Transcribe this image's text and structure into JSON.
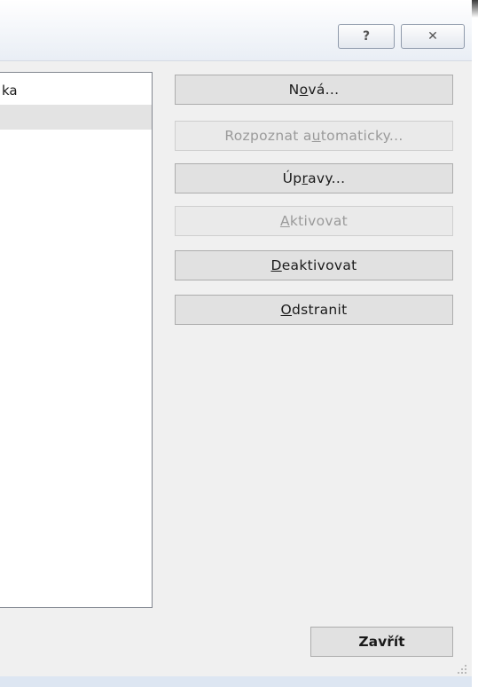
{
  "titlebar": {
    "help_glyph": "?",
    "close_glyph": "✕"
  },
  "list": {
    "items": [
      "ka",
      ""
    ]
  },
  "buttons": {
    "new": {
      "pre": "N",
      "u": "o",
      "post": "vá..."
    },
    "auto": {
      "pre": "Rozpoznat a",
      "u": "u",
      "post": "tomaticky..."
    },
    "edit": {
      "pre": "Úp",
      "u": "r",
      "post": "avy..."
    },
    "activate": {
      "pre": "",
      "u": "A",
      "post": "ktivovat"
    },
    "deactivate": {
      "pre": "",
      "u": "D",
      "post": "eaktivovat"
    },
    "remove": {
      "pre": "",
      "u": "O",
      "post": "dstranit"
    },
    "close": "Zavřít"
  },
  "colors": {
    "titlebar": "#e9eef5",
    "dialog_bg": "#f0f0f0",
    "button_bg": "#e1e1e1",
    "disabled_text": "#9a9a9a"
  }
}
